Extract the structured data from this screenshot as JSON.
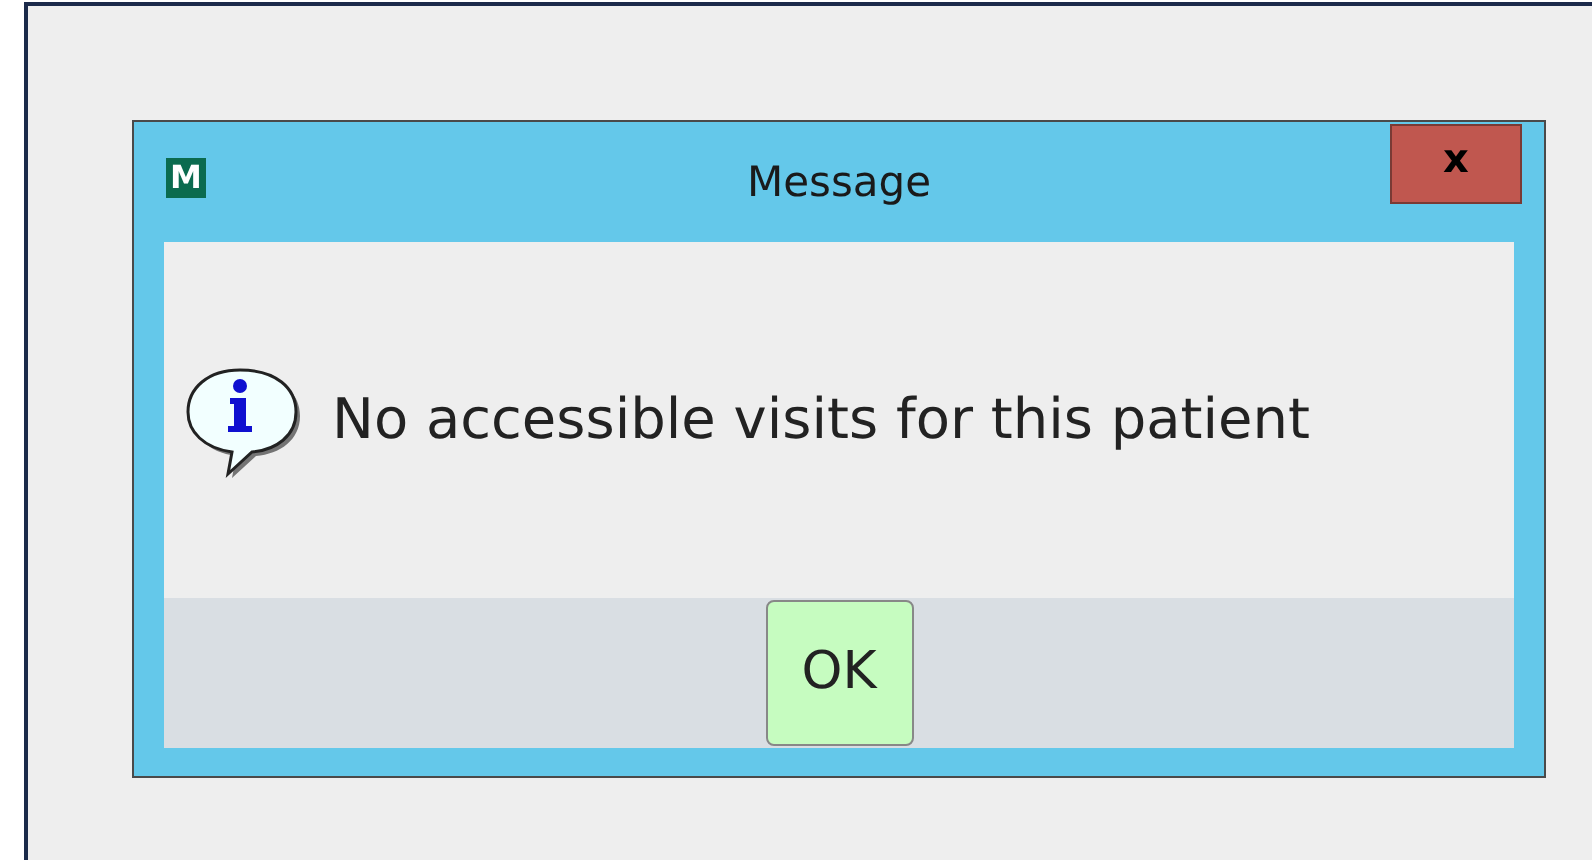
{
  "dialog": {
    "app_icon": "M",
    "title": "Message",
    "close_label": "x",
    "message": "No accessible visits for this patient",
    "buttons": [
      "OK"
    ]
  }
}
